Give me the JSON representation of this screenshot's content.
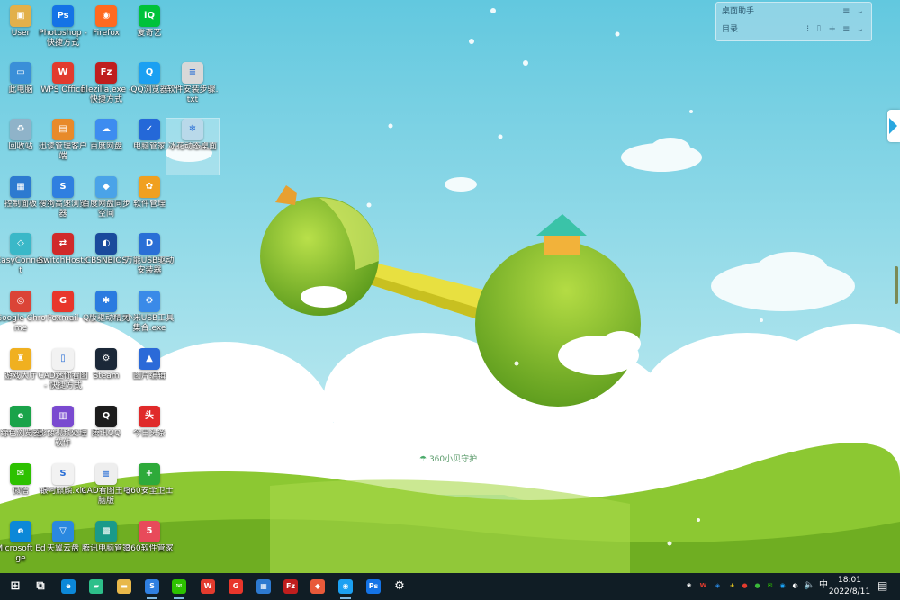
{
  "wallpaper": {
    "watermark": "360小贝守护",
    "sky": "#6dcde0",
    "grass": "#8cc832"
  },
  "desktop_icons": [
    {
      "label": "User",
      "icon": "user-folder-icon",
      "color": "#e2b04a",
      "glyph": "▣"
    },
    {
      "label": "Photoshop - 快捷方式",
      "icon": "photoshop-icon",
      "color": "#1473e6",
      "glyph": "Ps"
    },
    {
      "label": "Firefox",
      "icon": "firefox-icon",
      "color": "#ff6a1f",
      "glyph": "◉"
    },
    {
      "label": "爱奇艺",
      "icon": "iqiyi-icon",
      "color": "#00c23a",
      "glyph": "iQ"
    },
    {
      "label": "此电脑",
      "icon": "computer-icon",
      "color": "#3a8fd8",
      "glyph": "▭"
    },
    {
      "label": "WPS Office",
      "icon": "wps-icon",
      "color": "#e23b2e",
      "glyph": "W"
    },
    {
      "label": "filezilla.exe - 快捷方式",
      "icon": "filezilla-icon",
      "color": "#bf1e1e",
      "glyph": "Fz"
    },
    {
      "label": "QQ浏览器",
      "icon": "qq-browser-icon",
      "color": "#1ba0f2",
      "glyph": "Q"
    },
    {
      "label": "软件安装步骤.txt",
      "icon": "text-file-icon",
      "color": "#d8d8d8",
      "glyph": "≡"
    },
    {
      "label": "回收站",
      "icon": "recycle-bin-icon",
      "color": "#8fb3c9",
      "glyph": "♻"
    },
    {
      "label": "迅读管理客户端",
      "icon": "reader-app-icon",
      "color": "#e88a2a",
      "glyph": "▤"
    },
    {
      "label": "百度网盘",
      "icon": "baidu-netdisk-icon",
      "color": "#3d8cf0",
      "glyph": "☁"
    },
    {
      "label": "电脑管家",
      "icon": "pc-manager-icon",
      "color": "#2468d8",
      "glyph": "✓"
    },
    {
      "label": "冰花动态桌面",
      "icon": "snowflake-icon",
      "color": "#b9d9ea",
      "glyph": "❄"
    },
    {
      "label": "控制面板",
      "icon": "control-panel-icon",
      "color": "#2d7ad0",
      "glyph": "▦"
    },
    {
      "label": "搜狗高速浏览器",
      "icon": "sogou-browser-icon",
      "color": "#2f7fe0",
      "glyph": "S"
    },
    {
      "label": "百度网盘同步空间",
      "icon": "sync-space-icon",
      "color": "#4aa3e8",
      "glyph": "◆"
    },
    {
      "label": "软件管理",
      "icon": "software-manager-icon",
      "color": "#f0a020",
      "glyph": "✿"
    },
    {
      "label": "EasyConnect",
      "icon": "easyconnect-icon",
      "color": "#3ab8c8",
      "glyph": "◇"
    },
    {
      "label": "SwitchHosts",
      "icon": "switchhosts-icon",
      "color": "#d02a2a",
      "glyph": "⇄"
    },
    {
      "label": "CBSNBIOS",
      "icon": "bios-tool-icon",
      "color": "#1a4a9c",
      "glyph": "◐"
    },
    {
      "label": "万能USB驱动安装器",
      "icon": "driver-installer-icon",
      "color": "#2a6fd6",
      "glyph": "D"
    },
    {
      "label": "Google Chrome",
      "icon": "chrome-icon",
      "color": "#db4437",
      "glyph": "◎"
    },
    {
      "label": "Foxmail",
      "icon": "foxmail-icon",
      "color": "#e8362b",
      "glyph": "G"
    },
    {
      "label": "Q版驱动精灵",
      "icon": "driver-genius-icon",
      "color": "#2a7be0",
      "glyph": "✱"
    },
    {
      "label": "小米USB工具集合.exe",
      "icon": "usb-tool-icon",
      "color": "#3a8ae8",
      "glyph": "⚙"
    },
    {
      "label": "游戏大厅",
      "icon": "game-center-icon",
      "color": "#f0b020",
      "glyph": "♜"
    },
    {
      "label": "CAD迷你看图 - 快捷方式",
      "icon": "cad-viewer-icon",
      "color": "#f2f2f2",
      "glyph": "▯"
    },
    {
      "label": "Steam",
      "icon": "steam-icon",
      "color": "#1b2838",
      "glyph": "⚙"
    },
    {
      "label": "图片编辑",
      "icon": "photo-editor-icon",
      "color": "#2b6ad8",
      "glyph": "▲"
    },
    {
      "label": "绿色浏览器",
      "icon": "green-browser-icon",
      "color": "#1aa34a",
      "glyph": "e"
    },
    {
      "label": "影像视频处理软件",
      "icon": "media-app-icon",
      "color": "#7a4ad0",
      "glyph": "▥"
    },
    {
      "label": "腾讯QQ",
      "icon": "qq-icon",
      "color": "#1c1c1c",
      "glyph": "Q"
    },
    {
      "label": "今日头条",
      "icon": "news-app-icon",
      "color": "#e02a2a",
      "glyph": "头"
    },
    {
      "label": "微信",
      "icon": "wechat-icon",
      "color": "#2dc100",
      "glyph": "✉"
    },
    {
      "label": "银河麒麟.xls",
      "icon": "spreadsheet-icon",
      "color": "#f2f2f2",
      "glyph": "S"
    },
    {
      "label": "CAD看图王电脑版",
      "icon": "document-file-icon",
      "color": "#eeeeee",
      "glyph": "≣"
    },
    {
      "label": "360安全卫士",
      "icon": "360-security-icon",
      "color": "#2eaa3a",
      "glyph": "+"
    },
    {
      "label": "Microsoft Edge",
      "icon": "edge-icon",
      "color": "#0c88d8",
      "glyph": "e"
    },
    {
      "label": "天翼云盘",
      "icon": "cloud-drive-icon",
      "color": "#2a88e0",
      "glyph": "▽"
    },
    {
      "label": "腾讯电脑管家",
      "icon": "tencent-manager-icon",
      "color": "#1a9a8a",
      "glyph": "▩"
    },
    {
      "label": "360软件管家",
      "icon": "360-software-icon",
      "color": "#e84a5a",
      "glyph": "5"
    }
  ],
  "widget": {
    "title": "桌面助手",
    "subtitle": "目录",
    "title_tools": "≡ ⌄",
    "row_tools": "⁝ ⎍ + ≡ ⌄"
  },
  "taskbar": {
    "items": [
      {
        "name": "start-button",
        "glyph": "⊞",
        "color": "transparent",
        "active": false
      },
      {
        "name": "task-view-button",
        "glyph": "⧉",
        "color": "transparent",
        "active": false
      },
      {
        "name": "edge-taskbar-icon",
        "glyph": "e",
        "color": "#0c88d8",
        "active": false
      },
      {
        "name": "notes-taskbar-icon",
        "glyph": "▰",
        "color": "#2dbf8a",
        "active": false
      },
      {
        "name": "file-explorer-taskbar-icon",
        "glyph": "▬",
        "color": "#e8b84a",
        "active": false
      },
      {
        "name": "sogou-taskbar-icon",
        "glyph": "S",
        "color": "#2f7fe0",
        "active": true
      },
      {
        "name": "wechat-taskbar-icon",
        "glyph": "✉",
        "color": "#2dc100",
        "active": true
      },
      {
        "name": "wps-taskbar-icon",
        "glyph": "W",
        "color": "#e23b2e",
        "active": false
      },
      {
        "name": "foxmail-taskbar-icon",
        "glyph": "G",
        "color": "#e8362b",
        "active": false
      },
      {
        "name": "control-panel-taskbar-icon",
        "glyph": "▦",
        "color": "#2d7ad0",
        "active": false
      },
      {
        "name": "filezilla-taskbar-icon",
        "glyph": "Fz",
        "color": "#bf1e1e",
        "active": false
      },
      {
        "name": "app-taskbar-icon",
        "glyph": "◆",
        "color": "#e85a3a",
        "active": false
      },
      {
        "name": "browser-taskbar-icon",
        "glyph": "◉",
        "color": "#1ba0f2",
        "active": true
      },
      {
        "name": "photoshop-taskbar-icon",
        "glyph": "Ps",
        "color": "#1473e6",
        "active": false
      },
      {
        "name": "settings-taskbar-icon",
        "glyph": "⚙",
        "color": "transparent",
        "active": false
      }
    ],
    "tray": [
      {
        "name": "tray-app-1-icon",
        "glyph": "❀",
        "color": "#ffffff"
      },
      {
        "name": "tray-wps-icon",
        "glyph": "W",
        "color": "#e23b2e"
      },
      {
        "name": "tray-shield-icon",
        "glyph": "◈",
        "color": "#2a88e0"
      },
      {
        "name": "tray-360-icon",
        "glyph": "+",
        "color": "#e8c820"
      },
      {
        "name": "tray-app-2-icon",
        "glyph": "●",
        "color": "#e23b2e"
      },
      {
        "name": "tray-app-3-icon",
        "glyph": "●",
        "color": "#3ab83a"
      },
      {
        "name": "tray-wechat-icon",
        "glyph": "✉",
        "color": "#2dc100"
      },
      {
        "name": "tray-app-4-icon",
        "glyph": "◉",
        "color": "#1ba0f2"
      },
      {
        "name": "tray-app-5-icon",
        "glyph": "◐",
        "color": "#ffffff"
      },
      {
        "name": "tray-network-icon",
        "glyph": "▭",
        "color": "#ffffff"
      }
    ],
    "volume_icon": "🔈",
    "ime": "中",
    "clock_time": "18:01",
    "clock_date": "2022/8/11",
    "notification_icon": "▤"
  }
}
